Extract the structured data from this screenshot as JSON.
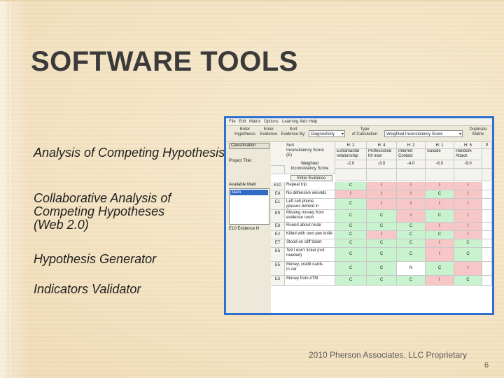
{
  "title": "SOFTWARE TOOLS",
  "bullets": [
    "Analysis of Competing Hypothesis (PARC)",
    "Collaborative Analysis of\nCompeting  Hypotheses\n(Web 2.0)",
    "Hypothesis Generator",
    "Indicators Validator"
  ],
  "footer": "2010 Pherson Associates, LLC  Proprietary",
  "page_number": "6",
  "app": {
    "menu": [
      "File",
      "Edit",
      "Matrix",
      "Options",
      "Learning Aids",
      "Help"
    ],
    "toolbar": {
      "enter_hypothesis": "Enter\nHypothesis",
      "enter_evidence": "Enter\nEvidence",
      "sort_by": "Sort\nEvidence By:",
      "sort_value": "Diagnosticity",
      "type_calc": "Type\nof Calculation",
      "calc_value": "Weighted Inconsistency Score",
      "duplicate": "Duplicate\nMatrix"
    },
    "left_panel": {
      "classification": "Classification",
      "project_title": "Project Title:",
      "available_matrices": "Available Matri",
      "selected_matrix": "Main",
      "evidence_label": "E10 Evidence N"
    },
    "grid": {
      "sort_score_label": "Sort\nInconsistency Score\n(E)",
      "weighted_label": "Weighted\nInconsistency Score",
      "enter_evidence_btn": "Enter Evidence",
      "hypotheses": [
        {
          "id": "H: 2",
          "name": "Extramarital\nrelationship",
          "score": "-2.0"
        },
        {
          "id": "H: 4",
          "name": "Professional\nhit man",
          "score": "-3.0"
        },
        {
          "id": "H: 2",
          "name": "Internet\nContact",
          "score": "-4.0"
        },
        {
          "id": "H: 1",
          "name": "Suicide",
          "score": "-6.0"
        },
        {
          "id": "H: 5",
          "name": "Random\nAttack",
          "score": "-9.0"
        }
      ],
      "extra_col": "P",
      "rows": [
        {
          "id": "E10",
          "text": "Repeat trip",
          "values": [
            "C",
            "I",
            "I",
            "I",
            "I"
          ]
        },
        {
          "id": "E4",
          "text": "No defensive wounds",
          "values": [
            "I",
            "I",
            "I",
            "C",
            "I"
          ]
        },
        {
          "id": "E1",
          "text": "Left cell phone\nglasses behind in",
          "values": [
            "C",
            "I",
            "I",
            "I",
            "I"
          ]
        },
        {
          "id": "E9",
          "text": "Missing money from\nevidence room",
          "values": [
            "C",
            "C",
            "I",
            "C",
            "I"
          ]
        },
        {
          "id": "E8",
          "text": "Round about route",
          "values": [
            "C",
            "C",
            "C",
            "I",
            "I"
          ]
        },
        {
          "id": "E2",
          "text": "Killed with own pen knife",
          "values": [
            "C",
            "I",
            "C",
            "C",
            "I"
          ]
        },
        {
          "id": "E7",
          "text": "Stood on cliff ticket",
          "values": [
            "C",
            "C",
            "C",
            "I",
            "C"
          ]
        },
        {
          "id": "E6",
          "text": "Tell I don't ticket (not\nneeded)",
          "values": [
            "C",
            "C",
            "C",
            "I",
            "C"
          ]
        },
        {
          "id": "E5",
          "text": "Money, credit cards\nin car",
          "values": [
            "C",
            "C",
            "N",
            "C",
            "I"
          ]
        },
        {
          "id": "E3",
          "text": "Money from ATM",
          "values": [
            "C",
            "C",
            "C",
            "I",
            "C"
          ]
        }
      ]
    }
  }
}
